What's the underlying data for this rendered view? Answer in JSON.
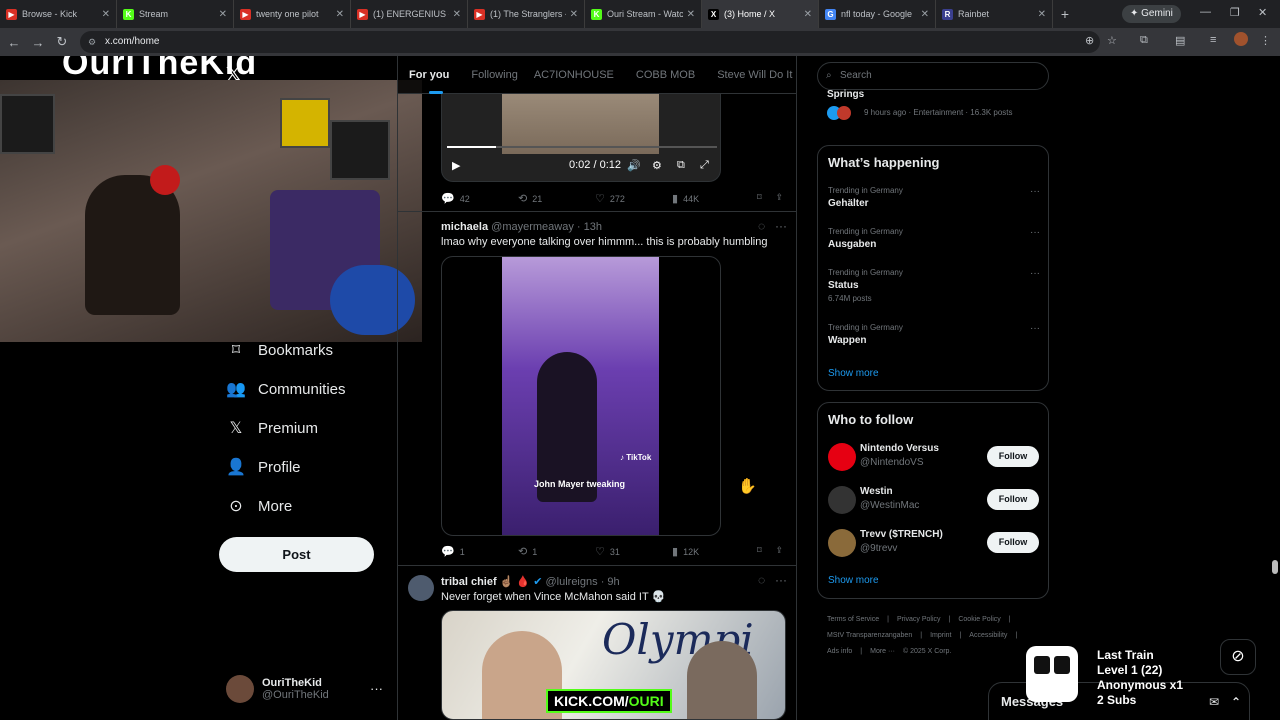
{
  "browser": {
    "tabs": [
      {
        "title": "Browse - Kick",
        "fav": "▶",
        "color": "#d93025"
      },
      {
        "title": "Stream",
        "fav": "K",
        "color": "#53fc18"
      },
      {
        "title": "twenty one pilot",
        "fav": "▶",
        "color": "#d93025"
      },
      {
        "title": "(1) ENERGENIUS - C",
        "fav": "▶",
        "color": "#d93025"
      },
      {
        "title": "(1) The Stranglers - ",
        "fav": "▶",
        "color": "#d93025"
      },
      {
        "title": "Ouri Stream - Watc",
        "fav": "K",
        "color": "#53fc18"
      },
      {
        "title": "(3) Home / X",
        "fav": "X",
        "color": "#000000"
      },
      {
        "title": "nfl today - Google",
        "fav": "G",
        "color": "#4285f4"
      },
      {
        "title": "Rainbet",
        "fav": "R",
        "color": "#3a3f8f"
      }
    ],
    "gemini_label": "✦ Gemini",
    "url": "x.com/home"
  },
  "stream_overlay": {
    "label": "OuriTheKid"
  },
  "nav": {
    "items": [
      {
        "label": "Bookmarks",
        "icon": "bookmark-icon"
      },
      {
        "label": "Communities",
        "icon": "communities-icon"
      },
      {
        "label": "Premium",
        "icon": "x-premium-icon"
      },
      {
        "label": "Profile",
        "icon": "profile-icon"
      },
      {
        "label": "More",
        "icon": "more-circle-icon"
      }
    ],
    "post_label": "Post",
    "account": {
      "name": "OuriTheKid",
      "handle": "@OuriTheKid"
    }
  },
  "feed": {
    "tabs": [
      "For you",
      "Following",
      "AC7IONHOUSE",
      "COBB MOB",
      "Steve Will Do It Loyal"
    ],
    "video1": {
      "time": "0:02 / 0:12",
      "progress": 0.18
    },
    "actions1": {
      "replies": "42",
      "reposts": "21",
      "likes": "272",
      "views": "44K"
    },
    "tweet2": {
      "name": "michaela",
      "handle": "@mayermeaway",
      "time": "· 13h",
      "text": "lmao why everyone talking over himmm... this is probably humbling",
      "caption": "John Mayer tweaking",
      "watermark": "♪ TikTok"
    },
    "actions2": {
      "replies": "1",
      "reposts": "1",
      "likes": "31",
      "views": "12K"
    },
    "tweet3": {
      "name": "tribal chief ☝🏽 🩸",
      "handle": "@lulreigns",
      "time": "· 9h",
      "text": "Never forget when Vince McMahon said IT 💀",
      "image_text": "Olympi",
      "kick_prefix": "KICK.COM/",
      "kick_name": "OURI"
    }
  },
  "right": {
    "search_placeholder": "Search",
    "top_item": {
      "title": "Springs",
      "meta": "9 hours ago · Entertainment · 16.3K posts"
    },
    "whats_happening": "What’s happening",
    "trends": [
      {
        "context": "Trending in Germany",
        "title": "Gehälter",
        "count": ""
      },
      {
        "context": "Trending in Germany",
        "title": "Ausgaben",
        "count": ""
      },
      {
        "context": "Trending in Germany",
        "title": "Status",
        "count": "6.74M posts"
      },
      {
        "context": "Trending in Germany",
        "title": "Wappen",
        "count": ""
      }
    ],
    "show_more": "Show more",
    "who_to_follow": "Who to follow",
    "follows": [
      {
        "name": "Nintendo Versus",
        "handle": "@NintendoVS",
        "color": "#e60012"
      },
      {
        "name": "Westin",
        "handle": "@WestinMac",
        "color": "#333333"
      },
      {
        "name": "Trevv ($TRENCH)",
        "handle": "@9trevv",
        "color": "#8a6a3a"
      }
    ],
    "follow_label": "Follow",
    "footer": [
      "Terms of Service",
      "|",
      "Privacy Policy",
      "|",
      "Cookie Policy",
      "|",
      "MStV Transparenzangaben",
      "|",
      "Imprint",
      "|",
      "Accessibility",
      "|",
      "Ads info",
      "|",
      "More ···",
      "© 2025 X Corp."
    ]
  },
  "messages_label": "Messages",
  "train": {
    "line1": "Last Train",
    "line2": "Level 1  (22)",
    "line3": "Anonymous x1",
    "line4": "2 Subs"
  }
}
